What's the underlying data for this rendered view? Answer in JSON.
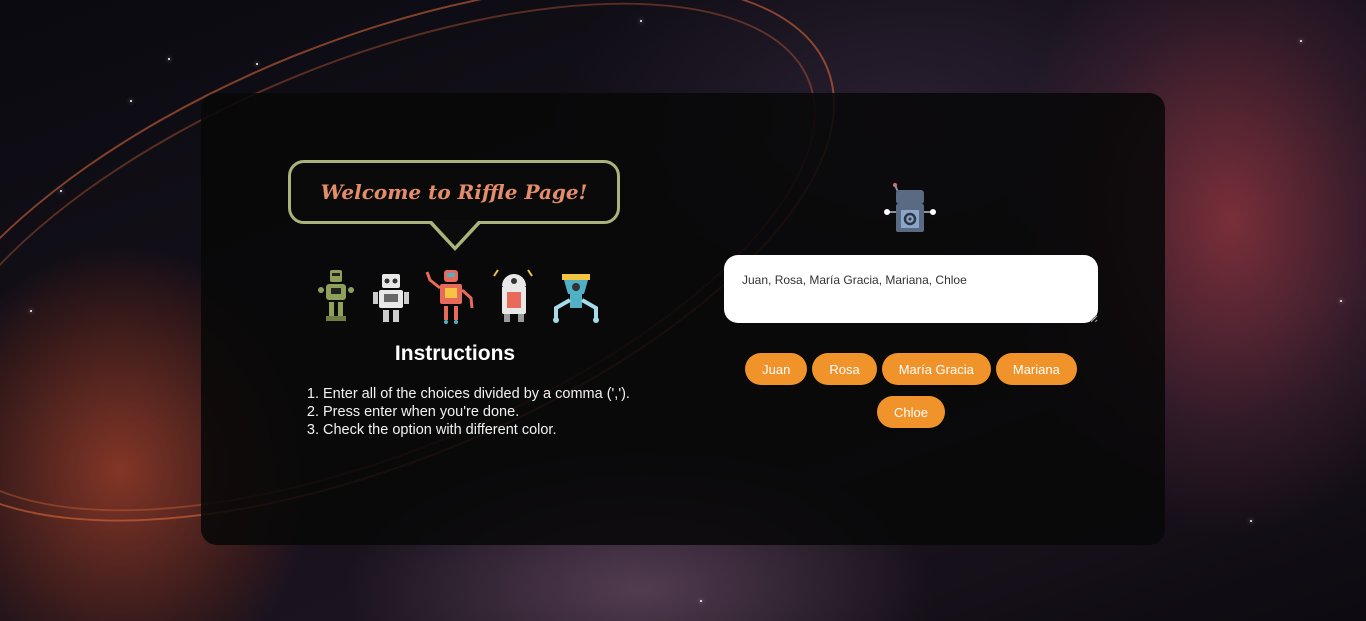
{
  "header": {
    "welcome_text": "Welcome to Riffle Page!"
  },
  "robots": [
    {
      "icon": "robot-green-icon"
    },
    {
      "icon": "robot-white-icon"
    },
    {
      "icon": "robot-red-waving-icon"
    },
    {
      "icon": "robot-dome-icon"
    },
    {
      "icon": "robot-blue-icon"
    }
  ],
  "instructions": {
    "title": "Instructions",
    "steps": [
      "Enter all of the choices divided by a comma (',').",
      "Press enter when you're done.",
      "Check the option with different color."
    ]
  },
  "input": {
    "value": "Juan, Rosa, María Gracia, Mariana, Chloe"
  },
  "choices": [
    "Juan",
    "Rosa",
    "María Gracia",
    "Mariana",
    "Chloe"
  ],
  "colors": {
    "accent": "#f0932b",
    "bubble_border": "#a8b47a",
    "welcome_text": "#e38d6a"
  }
}
